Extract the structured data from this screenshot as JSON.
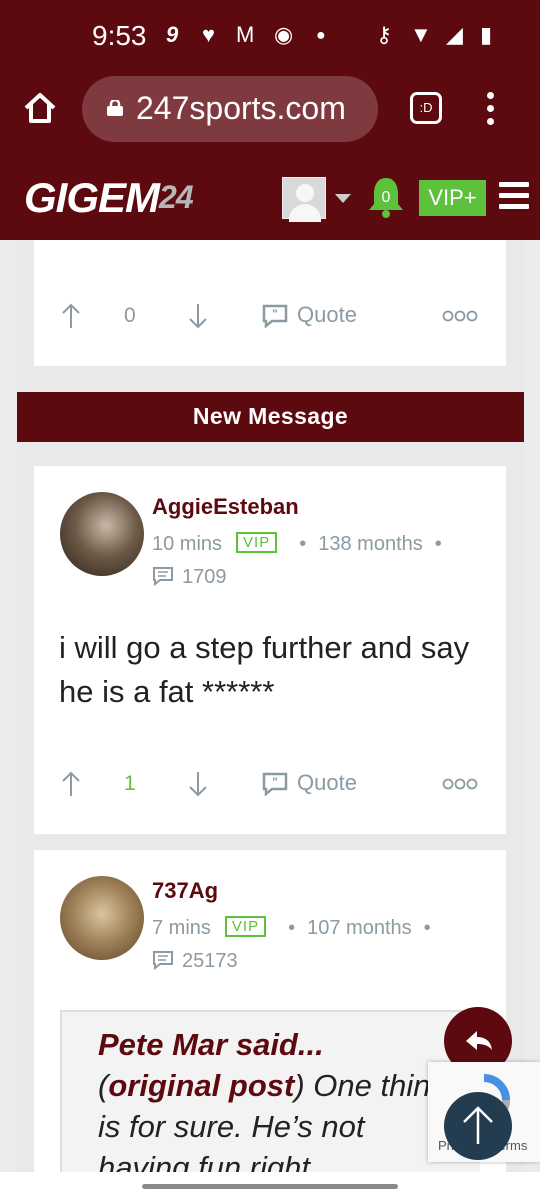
{
  "status_bar": {
    "time": "9:53",
    "icons": [
      "9-icon",
      "heart-icon",
      "gmail-icon",
      "chrome-icon",
      "dot-icon",
      "key-icon",
      "wifi-icon",
      "no-signal-icon",
      "battery-icon"
    ]
  },
  "browser": {
    "url": "247sports.com",
    "tab_icon_label": ":D"
  },
  "site_header": {
    "logo_main": "GIGEM",
    "logo_sub": "24",
    "notification_count": "0",
    "vip_label": "VIP+"
  },
  "colors": {
    "brand": "#5c0a0f",
    "vip_green": "#5ec13c",
    "meta_gray": "#8c9aa3"
  },
  "previous_post": {
    "upvotes": "0",
    "quote_label": "Quote"
  },
  "divider": {
    "label": "New Message"
  },
  "posts": [
    {
      "username": "AggieEsteban",
      "time_ago": "10 mins",
      "vip_badge": "VIP",
      "tenure": "138 months",
      "post_count": "1709",
      "body": "i will go a step further and say he is a fat ******",
      "upvotes": "1",
      "quote_label": "Quote"
    },
    {
      "username": "737Ag",
      "time_ago": "7 mins",
      "vip_badge": "VIP",
      "tenure": "107 months",
      "post_count": "25173",
      "quote": {
        "author_said": "Pete Mar said...",
        "original_link": "original post",
        "text": "One thing is for sure. He’s not having fun right"
      }
    }
  ],
  "recaptcha": {
    "links": "Privacy - Terms"
  }
}
